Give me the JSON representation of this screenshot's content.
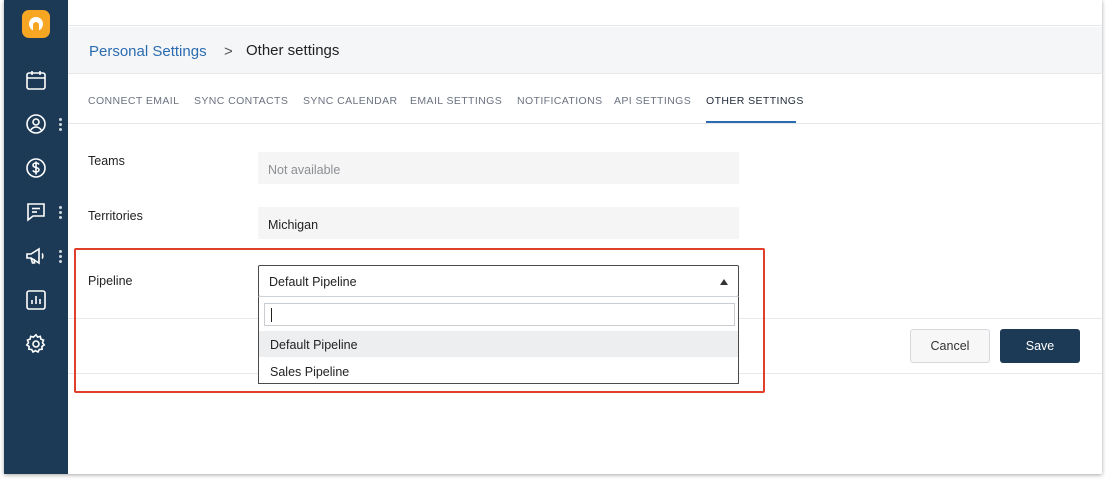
{
  "sidebar": {
    "icons": [
      "logo-icon",
      "calendar-icon",
      "contact-icon",
      "dollar-icon",
      "chat-icon",
      "megaphone-icon",
      "report-icon",
      "gear-icon"
    ]
  },
  "breadcrumb": {
    "parent": "Personal Settings",
    "separator": ">",
    "current": "Other settings"
  },
  "tabs": [
    {
      "label": "CONNECT EMAIL"
    },
    {
      "label": "SYNC CONTACTS"
    },
    {
      "label": "SYNC CALENDAR"
    },
    {
      "label": "EMAIL SETTINGS"
    },
    {
      "label": "NOTIFICATIONS"
    },
    {
      "label": "API SETTINGS"
    },
    {
      "label": "OTHER SETTINGS"
    }
  ],
  "active_tab": "OTHER SETTINGS",
  "form": {
    "teams_label": "Teams",
    "teams_value": "Not available",
    "territories_label": "Territories",
    "territories_value": "Michigan",
    "pipeline_label": "Pipeline",
    "pipeline_value": "Default Pipeline",
    "pipeline_search_value": "",
    "pipeline_options": [
      "Default Pipeline",
      "Sales Pipeline"
    ]
  },
  "actions": {
    "cancel_label": "Cancel",
    "save_label": "Save"
  },
  "colors": {
    "sidebar": "#1c3a55",
    "accent": "#2b6cb0",
    "highlight": "#e0402a",
    "logo": "#f6a623"
  }
}
